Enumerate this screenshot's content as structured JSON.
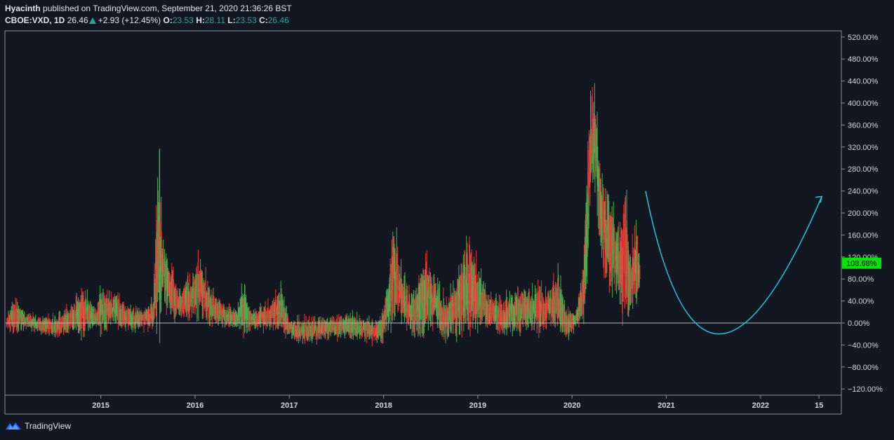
{
  "header": {
    "author": "Hyacinth",
    "published_text": "published on TradingView.com, September 21, 2020 21:36:26 BST",
    "symbol": "CBOE:VXD, 1D",
    "last": "26.46",
    "change": "+2.93 (+12.45%)",
    "o_label": "O:",
    "o_value": "23.53",
    "h_label": "H:",
    "h_value": "28.11",
    "l_label": "L:",
    "l_value": "23.53",
    "c_label": "C:",
    "c_value": "26.46"
  },
  "footer": {
    "brand": "TradingView"
  },
  "colors": {
    "background": "#131722",
    "up": "#4caf50",
    "down": "#e53935",
    "arrow": "#26c6da",
    "price_label": "#00e600"
  },
  "chart_data": {
    "type": "candlestick",
    "y_unit": "%",
    "ylim": [
      -130,
      530
    ],
    "y_ticks": [
      "520.00%",
      "480.00%",
      "440.00%",
      "400.00%",
      "360.00%",
      "320.00%",
      "280.00%",
      "240.00%",
      "200.00%",
      "160.00%",
      "120.00%",
      "80.00%",
      "40.00%",
      "0.00%",
      "−40.00%",
      "−80.00%",
      "−120.00%"
    ],
    "y_tick_values": [
      520,
      480,
      440,
      400,
      360,
      320,
      280,
      240,
      200,
      160,
      120,
      80,
      40,
      0,
      -40,
      -80,
      -120
    ],
    "x_ticks": [
      "2015",
      "2016",
      "2017",
      "2018",
      "2019",
      "2020",
      "2021",
      "2022",
      "15"
    ],
    "x_tick_values": [
      2015.0,
      2016.0,
      2017.0,
      2018.0,
      2019.0,
      2020.0,
      2021.0,
      2022.0,
      2022.62
    ],
    "xlim": [
      2013.99,
      2022.85
    ],
    "last_value_label": "108.68%",
    "last_value": 108.68,
    "zero_line": 0,
    "series_envelope": [
      [
        2014.0,
        -5,
        10
      ],
      [
        2014.08,
        -10,
        60
      ],
      [
        2014.2,
        -5,
        25
      ],
      [
        2014.35,
        -15,
        15
      ],
      [
        2014.55,
        -20,
        20
      ],
      [
        2014.7,
        -5,
        45
      ],
      [
        2014.8,
        -10,
        80
      ],
      [
        2014.95,
        0,
        30
      ],
      [
        2015.0,
        -5,
        75
      ],
      [
        2015.15,
        5,
        60
      ],
      [
        2015.3,
        -10,
        40
      ],
      [
        2015.45,
        -5,
        30
      ],
      [
        2015.55,
        -5,
        50
      ],
      [
        2015.62,
        20,
        345
      ],
      [
        2015.65,
        60,
        180
      ],
      [
        2015.75,
        20,
        110
      ],
      [
        2015.85,
        10,
        70
      ],
      [
        2015.95,
        20,
        100
      ],
      [
        2016.05,
        30,
        140
      ],
      [
        2016.15,
        10,
        80
      ],
      [
        2016.3,
        0,
        40
      ],
      [
        2016.45,
        -5,
        30
      ],
      [
        2016.5,
        -10,
        85
      ],
      [
        2016.6,
        -5,
        30
      ],
      [
        2016.75,
        -5,
        40
      ],
      [
        2016.85,
        0,
        60
      ],
      [
        2016.92,
        -10,
        80
      ],
      [
        2017.0,
        -20,
        10
      ],
      [
        2017.1,
        -30,
        15
      ],
      [
        2017.3,
        -25,
        20
      ],
      [
        2017.5,
        -20,
        15
      ],
      [
        2017.65,
        -20,
        25
      ],
      [
        2017.8,
        -25,
        15
      ],
      [
        2017.95,
        -30,
        10
      ],
      [
        2018.0,
        -20,
        40
      ],
      [
        2018.05,
        0,
        100
      ],
      [
        2018.1,
        30,
        220
      ],
      [
        2018.2,
        10,
        100
      ],
      [
        2018.3,
        -10,
        70
      ],
      [
        2018.45,
        0,
        150
      ],
      [
        2018.55,
        10,
        90
      ],
      [
        2018.65,
        -20,
        60
      ],
      [
        2018.75,
        -10,
        80
      ],
      [
        2018.85,
        0,
        160
      ],
      [
        2018.95,
        5,
        155
      ],
      [
        2019.0,
        10,
        120
      ],
      [
        2019.1,
        0,
        60
      ],
      [
        2019.25,
        -10,
        50
      ],
      [
        2019.4,
        -10,
        80
      ],
      [
        2019.55,
        0,
        70
      ],
      [
        2019.65,
        -10,
        80
      ],
      [
        2019.75,
        10,
        70
      ],
      [
        2019.85,
        0,
        110
      ],
      [
        2019.95,
        -20,
        30
      ],
      [
        2020.0,
        -15,
        30
      ],
      [
        2020.05,
        0,
        30
      ],
      [
        2020.12,
        20,
        120
      ],
      [
        2020.16,
        100,
        330
      ],
      [
        2020.2,
        250,
        460
      ],
      [
        2020.25,
        280,
        430
      ],
      [
        2020.3,
        150,
        300
      ],
      [
        2020.35,
        100,
        280
      ],
      [
        2020.45,
        80,
        230
      ],
      [
        2020.5,
        50,
        180
      ],
      [
        2020.55,
        40,
        310
      ],
      [
        2020.62,
        40,
        150
      ],
      [
        2020.7,
        60,
        200
      ],
      [
        2020.72,
        80,
        109
      ]
    ],
    "annotation_arrow": {
      "type": "curve",
      "points": [
        [
          2020.78,
          240
        ],
        [
          2021.55,
          -20
        ],
        [
          2022.65,
          230
        ]
      ]
    }
  }
}
